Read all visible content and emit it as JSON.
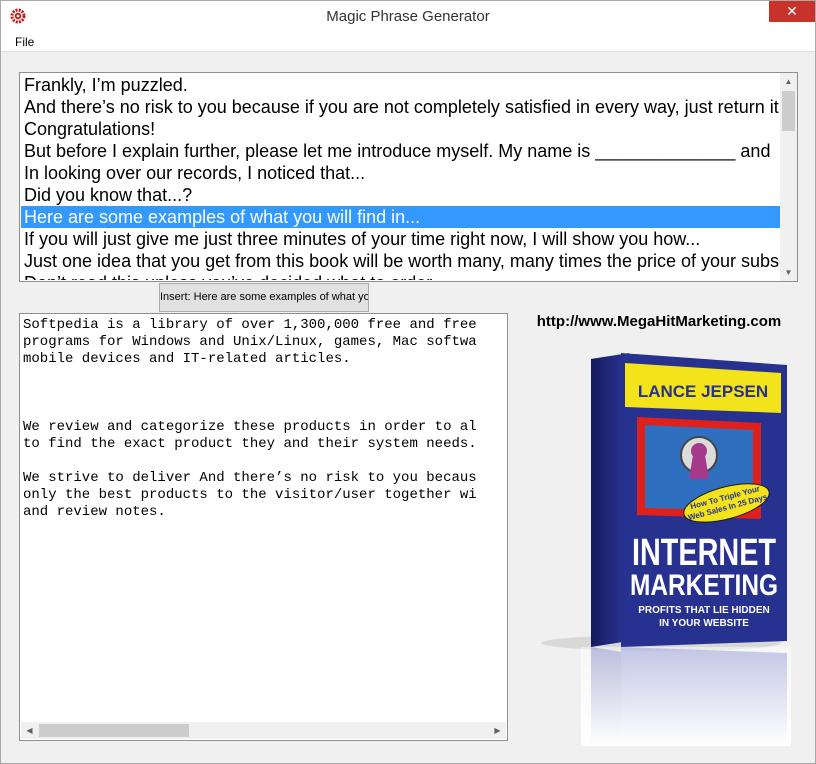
{
  "window": {
    "title": "Magic Phrase Generator",
    "close_label": "✕"
  },
  "menu": {
    "file": "File"
  },
  "phrases": {
    "items": [
      "Frankly, I’m puzzled.",
      "And there’s no risk to you because if you are not completely satisfied in every way, just return it",
      "Congratulations!",
      "But before I explain further, please let me introduce myself. My name is ______________ and",
      "In looking over our records, I noticed that...",
      "Did you know that...?",
      "Here are some examples of what you will find in...",
      "If you will just give me just three minutes of your time right now, I will show you how...",
      "Just one idea that you get from this book will be worth many, many times the price of your subscription",
      "Don’t read this unless you’ve decided what to order."
    ],
    "selected_index": 6
  },
  "insert_button": {
    "label": "Insert: Here are some examples of what you"
  },
  "editor": {
    "text": "Softpedia is a library of over 1,300,000 free and free\nprograms for Windows and Unix/Linux, games, Mac softwa\nmobile devices and IT-related articles.\n\n\n\nWe review and categorize these products in order to al\nto find the exact product they and their system needs.\n\nWe strive to deliver And there’s no risk to you becaus\nonly the best products to the visitor/user together wi\nand review notes."
  },
  "promo": {
    "url": "http://www.MegaHitMarketing.com",
    "book": {
      "author": "LANCE JEPSEN",
      "badge_line1": "How To Triple Your",
      "badge_line2": "Web Sales In 25 Days",
      "title_line1": "INTERNET",
      "title_line2": "MARKETING",
      "subtitle_line1": "PROFITS THAT LIE HIDDEN",
      "subtitle_line2": "IN YOUR WEBSITE"
    }
  },
  "colors": {
    "selection": "#3399ff",
    "close_button": "#c7322b",
    "book_blue": "#27318f",
    "book_yellow": "#f2e31b"
  }
}
